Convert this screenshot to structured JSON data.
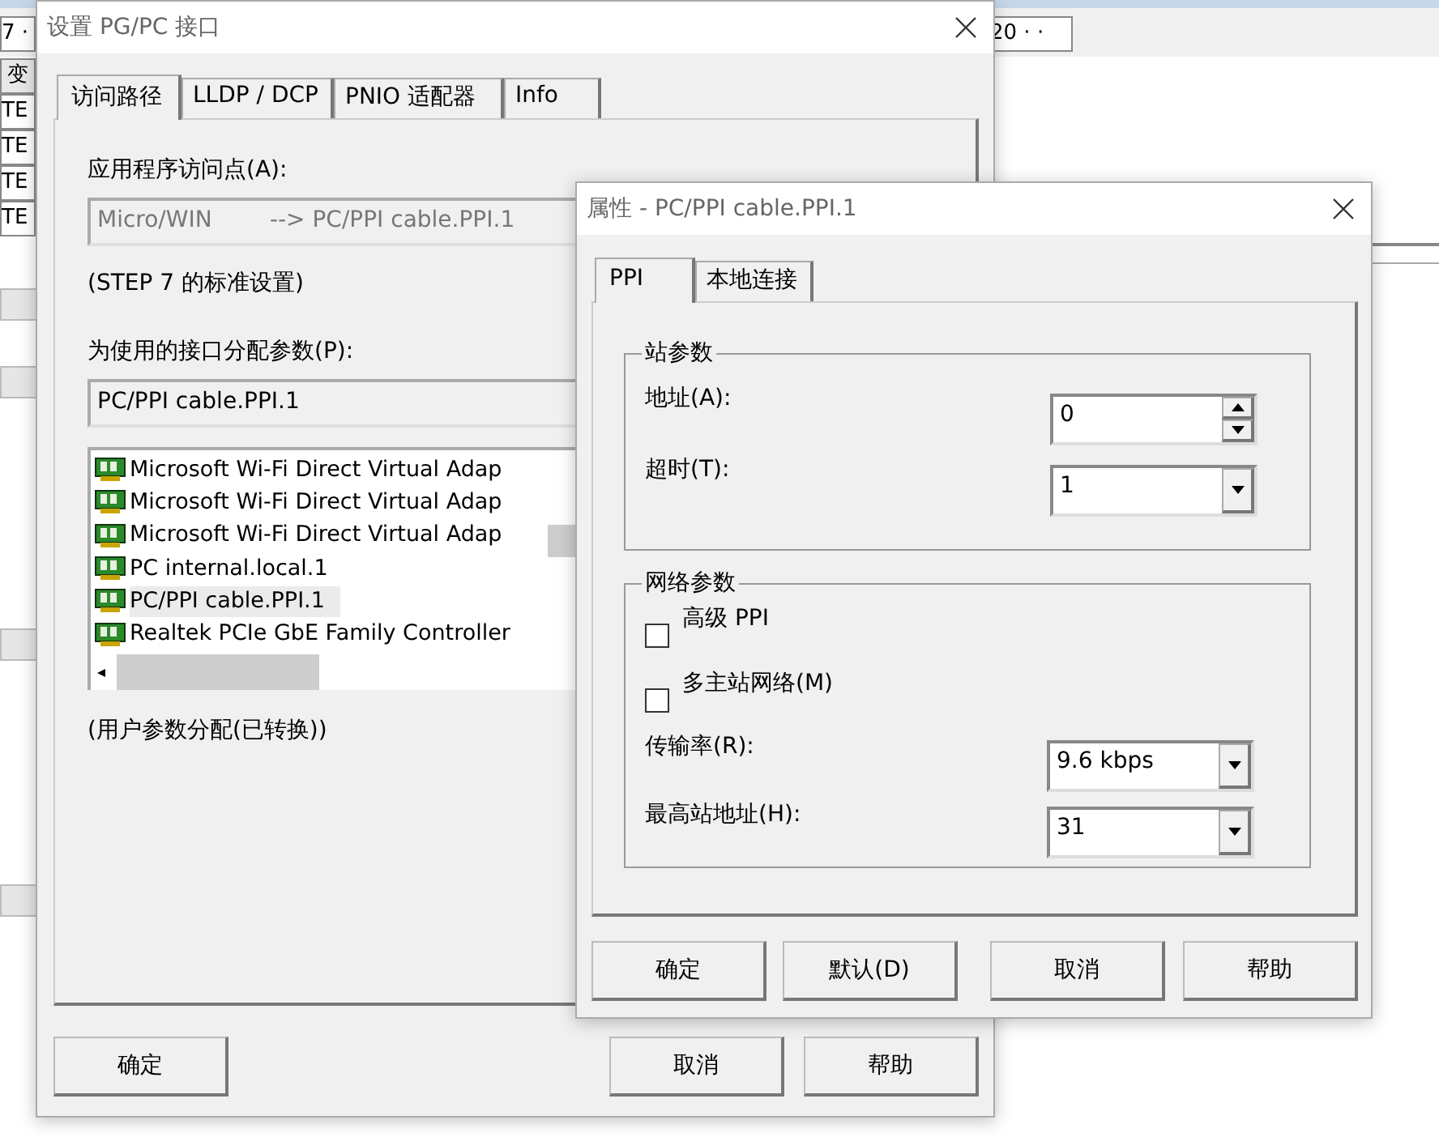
{
  "background": {
    "left_cells": [
      "7 ·",
      "变",
      "TE",
      "TE",
      "TE",
      "TE"
    ],
    "right_field": "20 · ·"
  },
  "pgpc_dialog": {
    "title": "设置 PG/PC 接口",
    "tabs": [
      {
        "label": "访问路径",
        "selected": true
      },
      {
        "label": "LLDP / DCP",
        "selected": false
      },
      {
        "label": "PNIO 适配器",
        "selected": false
      },
      {
        "label": "Info",
        "selected": false
      }
    ],
    "access_point_label": "应用程序访问点(A):",
    "access_point_value": "Micro/WIN        --> PC/PPI cable.PPI.1",
    "standard_note": "(STEP 7 的标准设置)",
    "interface_label": "为使用的接口分配参数(P):",
    "interface_value": "PC/PPI cable.PPI.1",
    "interfaces": [
      {
        "label": "Microsoft Wi-Fi Direct Virtual Adap",
        "selected": false
      },
      {
        "label": "Microsoft Wi-Fi Direct Virtual Adap",
        "selected": false
      },
      {
        "label": "Microsoft Wi-Fi Direct Virtual Adap",
        "selected": false
      },
      {
        "label": "PC internal.local.1",
        "selected": false
      },
      {
        "label": "PC/PPI cable.PPI.1",
        "selected": true
      },
      {
        "label": "Realtek PCIe GbE Family Controller",
        "selected": false
      }
    ],
    "user_note": "(用户参数分配(已转换))",
    "buttons": [
      "确定",
      "取消",
      "帮助"
    ]
  },
  "properties_dialog": {
    "title": "属性 - PC/PPI cable.PPI.1",
    "tabs": [
      {
        "label": "PPI",
        "selected": true
      },
      {
        "label": "本地连接",
        "selected": false
      }
    ],
    "station_group": {
      "title": "站参数",
      "address": {
        "label": "地址(A):",
        "value": "0"
      },
      "timeout": {
        "label": "超时(T):",
        "value": "1"
      }
    },
    "network_group": {
      "title": "网络参数",
      "advanced_ppi": {
        "label": "高级 PPI",
        "checked": false
      },
      "multi_master": {
        "label": "多主站网络(M)",
        "checked": false
      },
      "baud_rate": {
        "label": "传输率(R):",
        "value": "9.6 kbps"
      },
      "highest_address": {
        "label": "最高站地址(H):",
        "value": "31"
      }
    },
    "buttons": [
      "确定",
      "默认(D)",
      "取消",
      "帮助"
    ]
  }
}
